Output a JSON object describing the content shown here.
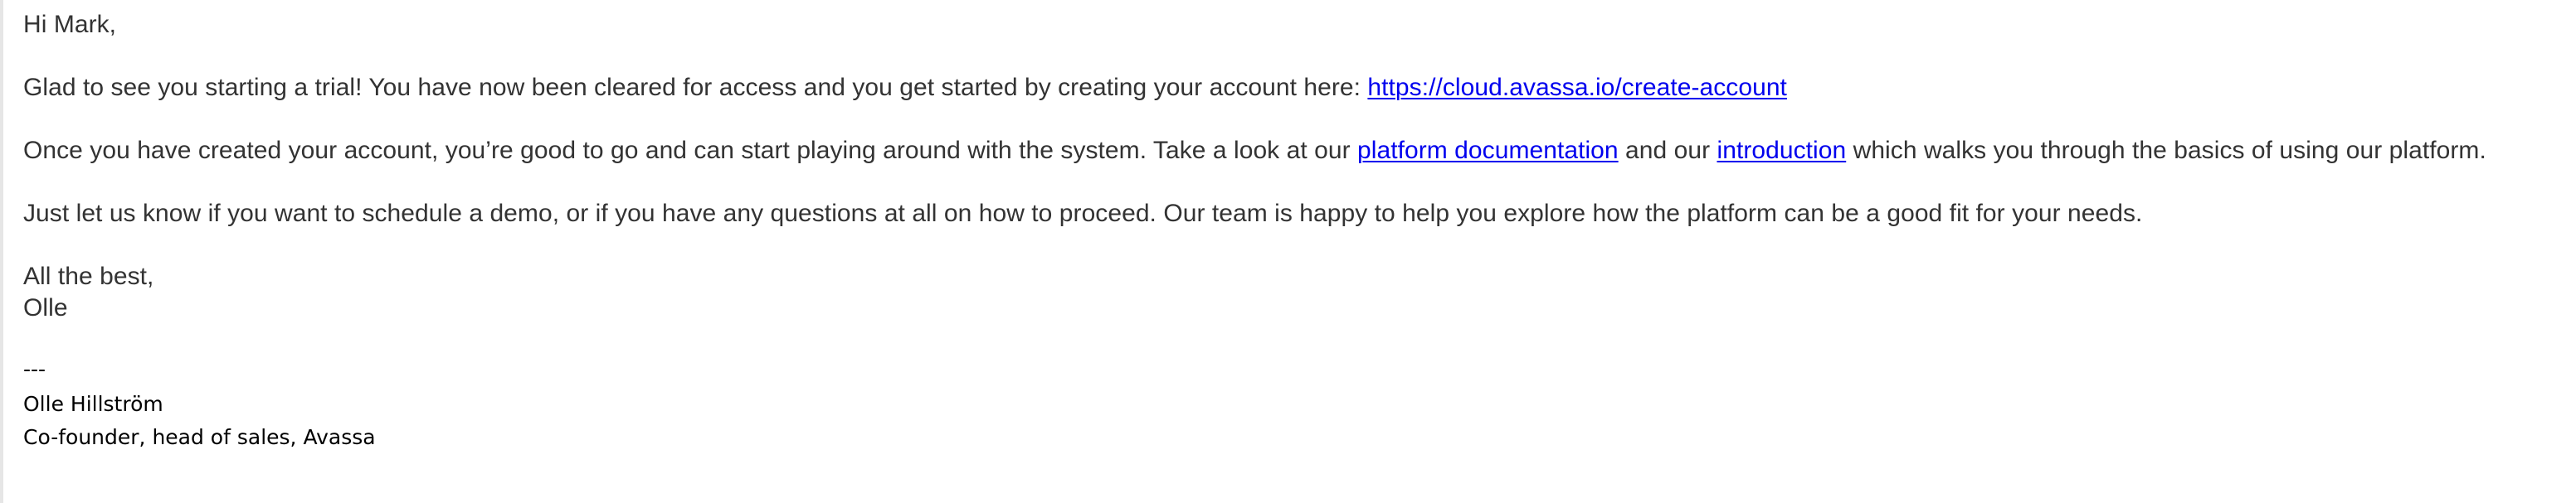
{
  "email": {
    "greeting": "Hi Mark,",
    "paragraph1": {
      "text": "Glad to see you starting a trial! You have now been cleared for access and you get started by creating your account here: ",
      "link": "https://cloud.avassa.io/create-account"
    },
    "paragraph2": {
      "text_before": "Once you have created your account, you’re good to go and can start playing around with the system. Take a look at our ",
      "link1": "platform documentation",
      "text_middle": " and our ",
      "link2": "introduction",
      "text_after": " which walks you through the basics of using our platform."
    },
    "paragraph3": "Just let us know if you want to schedule a demo, or if you have any questions at all on how to proceed. Our team is happy to help you explore how the platform can be a good fit for your needs.",
    "closing": "All the best,",
    "sender_first_name": "Olle",
    "separator": "---",
    "signature": {
      "name": "Olle Hillström",
      "title": "Co-founder, head of sales, Avassa"
    }
  },
  "colors": {
    "text": "#333333",
    "link": "#0000ee",
    "signature_text": "#000000",
    "background": "#ffffff"
  }
}
